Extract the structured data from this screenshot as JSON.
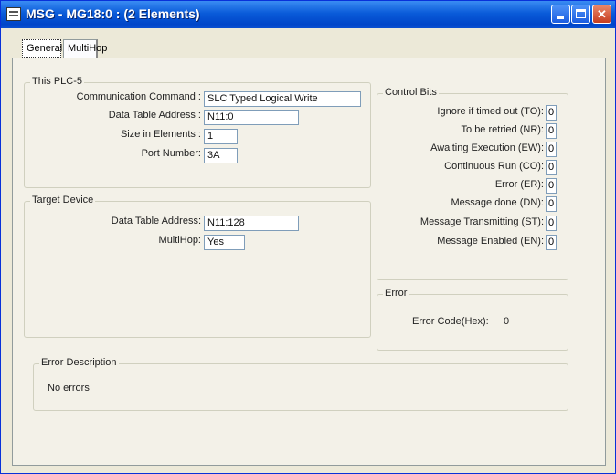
{
  "window": {
    "title": "MSG - MG18:0 : (2 Elements)"
  },
  "tabs": [
    {
      "label": "General"
    },
    {
      "label": "MultiHop"
    }
  ],
  "this_plc": {
    "title": "This PLC-5",
    "comm_label": "Communication Command :",
    "comm_value": "SLC Typed Logical Write",
    "address_label": "Data Table Address :",
    "address_value": "N11:0",
    "size_label": "Size in Elements :",
    "size_value": "1",
    "port_label": "Port Number:",
    "port_value": "3A"
  },
  "target": {
    "title": "Target Device",
    "address_label": "Data Table Address:",
    "address_value": "N11:128",
    "multihop_label": "MultiHop:",
    "multihop_value": "Yes"
  },
  "control_bits": {
    "title": "Control Bits",
    "items": [
      {
        "label": "Ignore if timed out (TO):",
        "value": "0"
      },
      {
        "label": "To be retried (NR):",
        "value": "0"
      },
      {
        "label": "Awaiting Execution (EW):",
        "value": "0"
      },
      {
        "label": "Continuous Run (CO):",
        "value": "0"
      },
      {
        "label": "Error (ER):",
        "value": "0"
      },
      {
        "label": "Message done (DN):",
        "value": "0"
      },
      {
        "label": "Message Transmitting (ST):",
        "value": "0"
      },
      {
        "label": "Message Enabled (EN):",
        "value": "0"
      }
    ]
  },
  "error": {
    "title": "Error",
    "code_label": "Error Code(Hex):",
    "code_value": "0"
  },
  "error_description": {
    "title": "Error Description",
    "text": "No errors"
  }
}
